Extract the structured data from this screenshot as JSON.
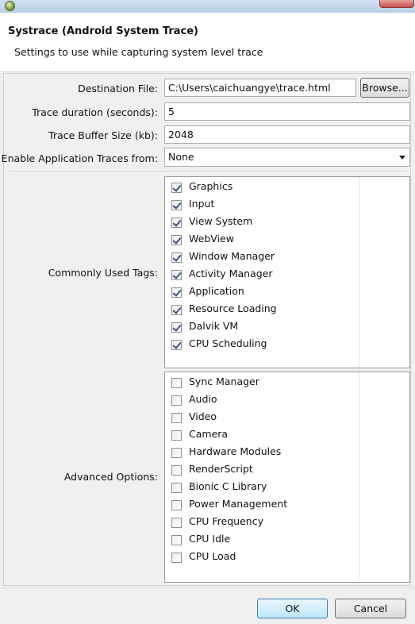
{
  "window": {
    "close_icon": "close-icon",
    "app_icon": "android-icon"
  },
  "dialog": {
    "title": "Systrace (Android System Trace)",
    "subtitle": "Settings to use while capturing system level trace"
  },
  "form": {
    "destination_label": "Destination File:",
    "destination_value": "C:\\Users\\caichuangye\\trace.html",
    "browse_label": "Browse...",
    "duration_label": "Trace duration (seconds):",
    "duration_value": "5",
    "buffer_label": "Trace Buffer Size (kb):",
    "buffer_value": "2048",
    "app_traces_label": "Enable Application Traces from:",
    "app_traces_value": "None"
  },
  "common_tags": {
    "label": "Commonly Used Tags:",
    "items": [
      {
        "label": "Graphics",
        "checked": true
      },
      {
        "label": "Input",
        "checked": true
      },
      {
        "label": "View System",
        "checked": true
      },
      {
        "label": "WebView",
        "checked": true
      },
      {
        "label": "Window Manager",
        "checked": true
      },
      {
        "label": "Activity Manager",
        "checked": true
      },
      {
        "label": "Application",
        "checked": true
      },
      {
        "label": "Resource Loading",
        "checked": true
      },
      {
        "label": "Dalvik VM",
        "checked": true
      },
      {
        "label": "CPU Scheduling",
        "checked": true
      }
    ]
  },
  "advanced": {
    "label": "Advanced Options:",
    "items": [
      {
        "label": "Sync Manager",
        "checked": false
      },
      {
        "label": "Audio",
        "checked": false
      },
      {
        "label": "Video",
        "checked": false
      },
      {
        "label": "Camera",
        "checked": false
      },
      {
        "label": "Hardware Modules",
        "checked": false
      },
      {
        "label": "RenderScript",
        "checked": false
      },
      {
        "label": "Bionic C Library",
        "checked": false
      },
      {
        "label": "Power Management",
        "checked": false
      },
      {
        "label": "CPU Frequency",
        "checked": false
      },
      {
        "label": "CPU Idle",
        "checked": false
      },
      {
        "label": "CPU Load",
        "checked": false
      }
    ]
  },
  "buttons": {
    "ok": "OK",
    "cancel": "Cancel"
  }
}
